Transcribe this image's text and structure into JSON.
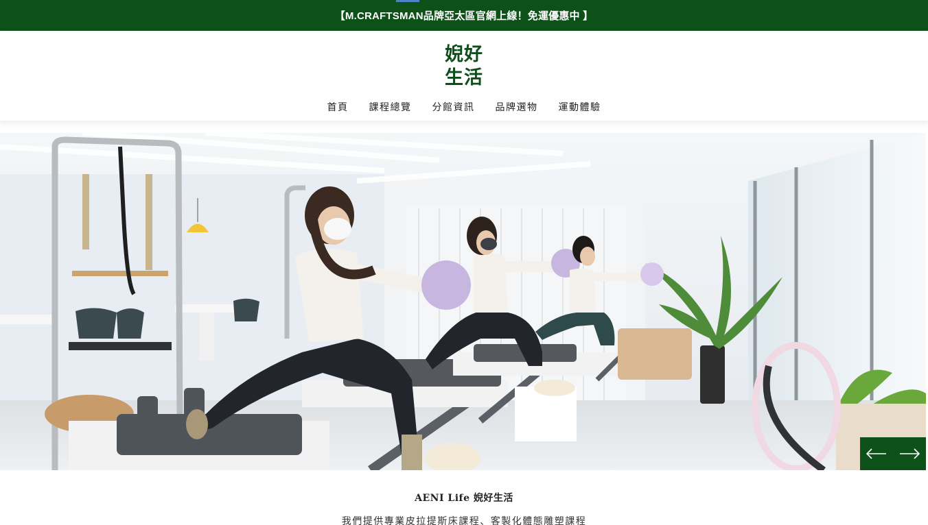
{
  "announcement": {
    "text": "【M.CRAFTSMAN品牌亞太區官網上線！免運優惠中 】"
  },
  "brand": {
    "line1": "婗好",
    "line2": "生活"
  },
  "nav": {
    "items": [
      {
        "label": "首頁"
      },
      {
        "label": "課程總覽"
      },
      {
        "label": "分館資訊"
      },
      {
        "label": "品牌選物"
      },
      {
        "label": "運動體驗"
      }
    ]
  },
  "hero": {
    "image": "pilates-studio-photo",
    "prev_icon": "arrow-left-icon",
    "next_icon": "arrow-right-icon"
  },
  "intro": {
    "title": "AENI Life 婗好生活",
    "text": "我們提供專業皮拉提斯床課程、客製化體態雕塑課程"
  },
  "colors": {
    "brand_green": "#0d5119",
    "logo_green": "#0d4d1a",
    "background": "#ffffff"
  }
}
